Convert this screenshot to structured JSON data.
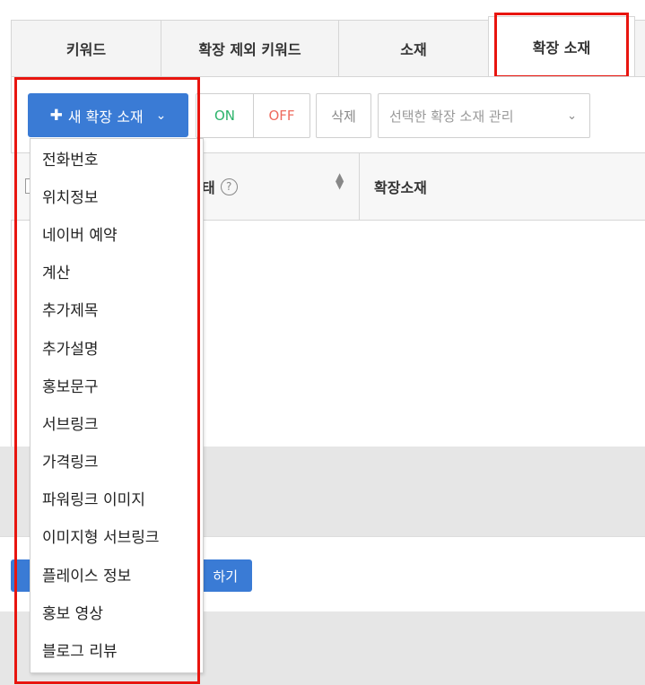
{
  "tabs": [
    {
      "label": "키워드"
    },
    {
      "label": "확장 제외 키워드"
    },
    {
      "label": "소재"
    },
    {
      "label": "확장 소재",
      "active": true
    }
  ],
  "toolbar": {
    "new_extension_label": "새 확장 소재",
    "on_label": "ON",
    "off_label": "OFF",
    "delete_label": "삭제",
    "manage_select_placeholder": "선택한 확장 소재 관리"
  },
  "table": {
    "columns": [
      "태",
      "확장소재"
    ]
  },
  "footer": {
    "apply_label": "하기"
  },
  "dropdown": {
    "items": [
      "전화번호",
      "위치정보",
      "네이버 예약",
      "계산",
      "추가제목",
      "추가설명",
      "홍보문구",
      "서브링크",
      "가격링크",
      "파워링크 이미지",
      "이미지형 서브링크",
      "플레이스 정보",
      "홍보 영상",
      "블로그 리뷰"
    ]
  },
  "colors": {
    "primary": "#3a7bd5",
    "on": "#2cb36b",
    "off": "#ee6b5e",
    "highlight": "#e8150f"
  }
}
